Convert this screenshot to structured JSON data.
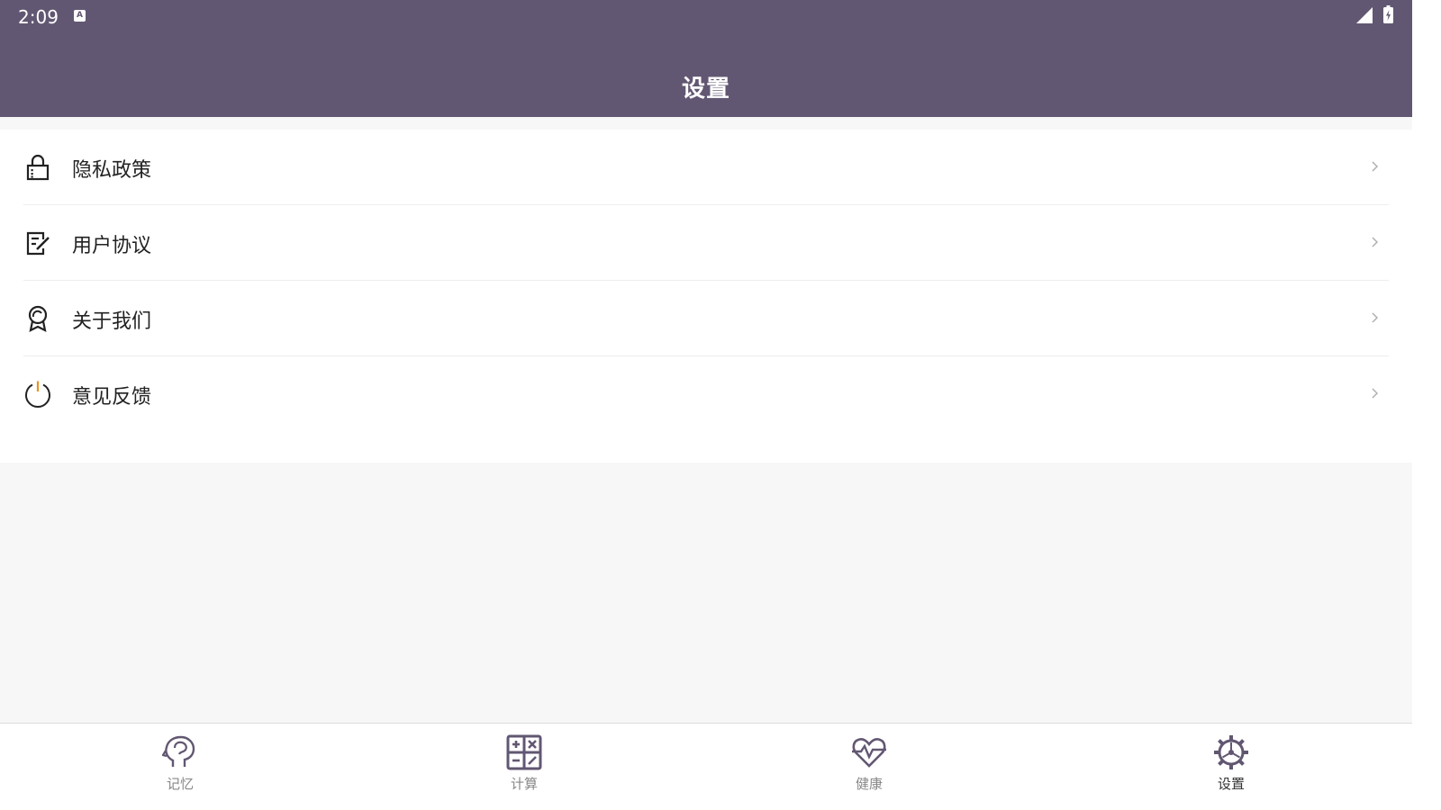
{
  "status_bar": {
    "time": "2:09",
    "notification_icon": "A"
  },
  "header": {
    "title": "设置"
  },
  "menu": {
    "items": [
      {
        "label": "隐私政策",
        "icon": "lock-icon"
      },
      {
        "label": "用户协议",
        "icon": "document-edit-icon"
      },
      {
        "label": "关于我们",
        "icon": "award-icon"
      },
      {
        "label": "意见反馈",
        "icon": "power-icon"
      }
    ]
  },
  "tabs": [
    {
      "label": "记忆",
      "icon": "brain-head-icon",
      "active": false
    },
    {
      "label": "计算",
      "icon": "calculator-icon",
      "active": false
    },
    {
      "label": "健康",
      "icon": "heart-pulse-icon",
      "active": false
    },
    {
      "label": "设置",
      "icon": "gear-icon",
      "active": true
    }
  ],
  "colors": {
    "header_bg": "#625772",
    "page_bg": "#f7f7f7",
    "text": "#222222",
    "tab_inactive": "#888888",
    "accent_orange": "#e8931e"
  }
}
